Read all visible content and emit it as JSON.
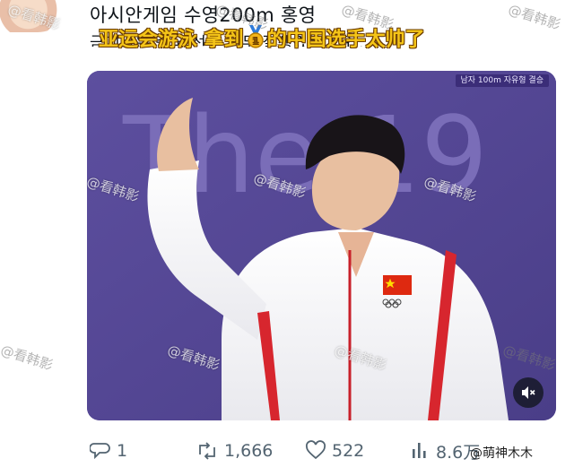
{
  "post": {
    "text_line1": "아시안게임 수영200m 홍영",
    "text_line2": "금메달은 중국 선수 너무 잘생겼는데요 ..",
    "overlay_caption_part1": "亚运会游泳 拿到",
    "overlay_caption_part2": "的中国选手太帅了",
    "medal_icon": "gold-medal-icon"
  },
  "media": {
    "broadcast_tag": "남자 100m 자유형 결승",
    "backdrop_text": "The 19"
  },
  "actions": {
    "replies": "1",
    "reposts": "1,666",
    "likes": "522",
    "views": "8.6万"
  },
  "watermarks": {
    "text": "@看韩影",
    "credit": "@萌神木木"
  },
  "colors": {
    "media_background": "#5a4c9a",
    "caption_fill": "#f5c518",
    "action_gray": "#536471"
  }
}
